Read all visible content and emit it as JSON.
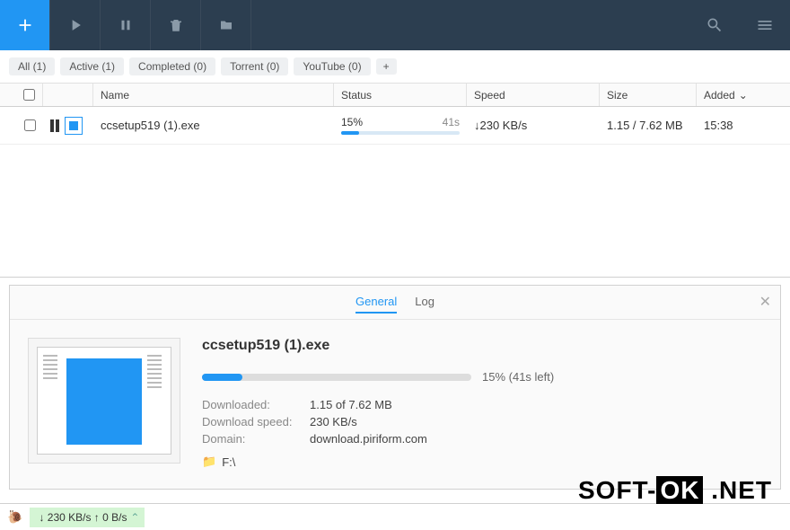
{
  "filters": {
    "all": "All (1)",
    "active": "Active (1)",
    "completed": "Completed (0)",
    "torrent": "Torrent (0)",
    "youtube": "YouTube (0)"
  },
  "columns": {
    "name": "Name",
    "status": "Status",
    "speed": "Speed",
    "size": "Size",
    "added": "Added"
  },
  "row": {
    "name": "ccsetup519 (1).exe",
    "percent": "15%",
    "time": "41s",
    "speed": "↓230 KB/s",
    "size": "1.15 / 7.62 MB",
    "added": "15:38",
    "progress_width": "15%"
  },
  "detail": {
    "tab_general": "General",
    "tab_log": "Log",
    "title": "ccsetup519 (1).exe",
    "progress_text": "15% (41s left)",
    "progress_width": "15%",
    "downloaded_label": "Downloaded:",
    "downloaded_value": "1.15 of 7.62 MB",
    "speed_label": "Download speed:",
    "speed_value": "230 KB/s",
    "domain_label": "Domain:",
    "domain_value": "download.piriform.com",
    "folder": "F:\\"
  },
  "statusbar": {
    "speeds": "↓ 230 KB/s  ↑ 0 B/s"
  },
  "watermark": {
    "p1": "SOFT-",
    "p2": "OK",
    "p3": ".NET"
  }
}
